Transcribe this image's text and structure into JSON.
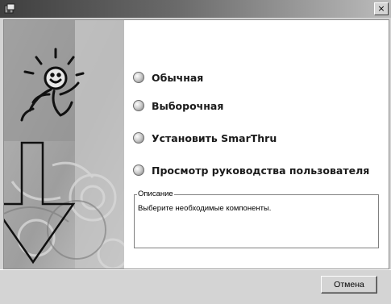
{
  "window": {
    "close_glyph": "×",
    "icons": {
      "app": "installer-app-icon",
      "close": "close-icon"
    }
  },
  "menu": {
    "bullet_icon": "radio-ball-icon",
    "items": [
      {
        "label": "Обычная"
      },
      {
        "label": "Выборочная"
      },
      {
        "label": "Установить SmarThru"
      },
      {
        "label": "Просмотр руководства пользователя"
      }
    ]
  },
  "description": {
    "legend": "Описание",
    "text": "Выберите необходимые компоненты."
  },
  "footer": {
    "cancel_label": "Отмена"
  },
  "colors": {
    "title_dark": "#3f3f3f",
    "title_light": "#bcbcbc",
    "panel": "#d4d4d4",
    "content": "#ffffff"
  }
}
